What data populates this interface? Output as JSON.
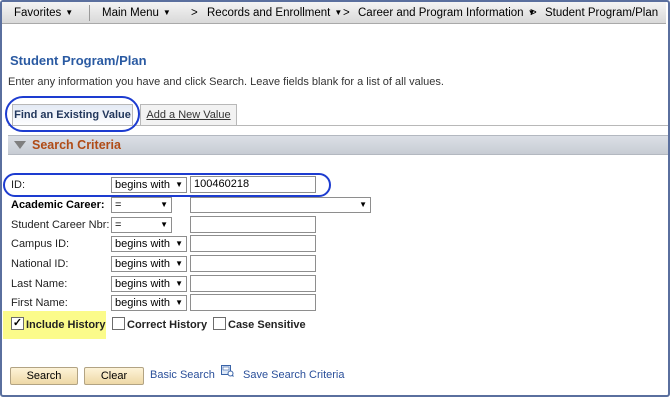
{
  "nav": {
    "favorites": "Favorites",
    "main_menu": "Main Menu",
    "crumb_sep": ">",
    "records": "Records and Enrollment",
    "career": "Career and Program Information",
    "student_plan": "Student Program/Plan"
  },
  "page": {
    "title": "Student Program/Plan",
    "instructions": "Enter any information you have and click Search. Leave fields blank for a list of all values."
  },
  "tabs": {
    "find": "Find an Existing Value",
    "add": "Add a New Value"
  },
  "criteria": {
    "title": "Search Criteria",
    "rows": [
      {
        "label": "ID:",
        "operator": "begins with",
        "value": "100460218"
      },
      {
        "label": "Academic Career:",
        "operator": "=",
        "value": ""
      },
      {
        "label": "Student Career Nbr:",
        "operator": "=",
        "value": ""
      },
      {
        "label": "Campus ID:",
        "operator": "begins with",
        "value": ""
      },
      {
        "label": "National ID:",
        "operator": "begins with",
        "value": ""
      },
      {
        "label": "Last Name:",
        "operator": "begins with",
        "value": ""
      },
      {
        "label": "First Name:",
        "operator": "begins with",
        "value": ""
      }
    ]
  },
  "options": {
    "include_history": {
      "label": "Include History",
      "checked": true
    },
    "correct_history": {
      "label": "Correct History",
      "checked": false
    },
    "case_sensitive": {
      "label": "Case Sensitive",
      "checked": false
    }
  },
  "actions": {
    "search": "Search",
    "clear": "Clear",
    "basic_search": "Basic Search",
    "save_criteria": "Save Search Criteria"
  },
  "colors": {
    "title_blue": "#2a5aa2",
    "section_orange": "#b04b16",
    "annotation_blue": "#1d3cd0",
    "highlight_yellow": "#fbfb8a"
  }
}
